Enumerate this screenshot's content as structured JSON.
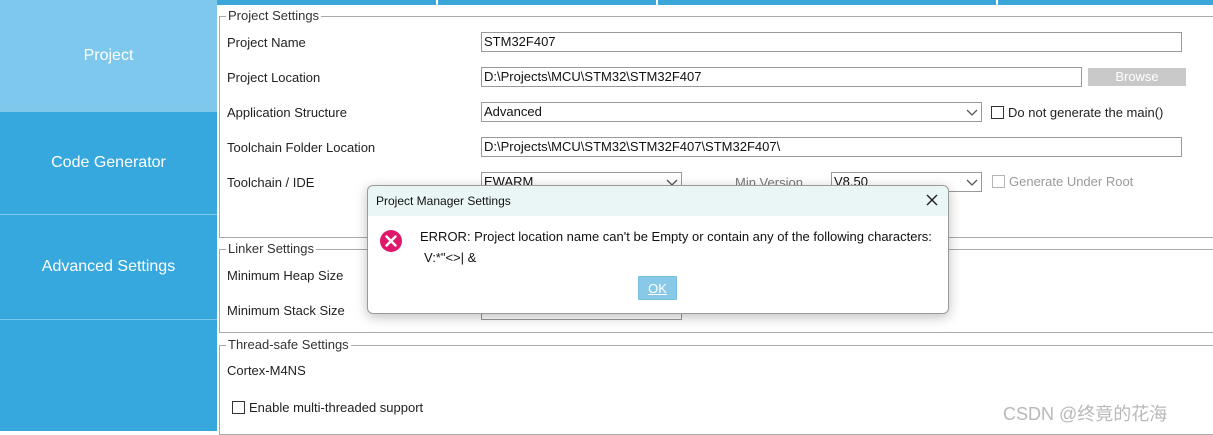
{
  "sidebar": {
    "items": [
      {
        "label": "Project",
        "active": true
      },
      {
        "label": "Code Generator",
        "active": false
      },
      {
        "label": "Advanced Settings",
        "active": false
      }
    ]
  },
  "project_settings": {
    "legend": "Project Settings",
    "project_name_label": "Project Name",
    "project_name_value": "STM32F407",
    "project_location_label": "Project Location",
    "project_location_value": "D:\\Projects\\MCU\\STM32\\STM32F407",
    "browse_label": "Browse",
    "app_structure_label": "Application Structure",
    "app_structure_value": "Advanced",
    "do_not_generate_main_label": "Do not generate the main()",
    "toolchain_folder_label": "Toolchain Folder Location",
    "toolchain_folder_value": "D:\\Projects\\MCU\\STM32\\STM32F407\\STM32F407\\",
    "toolchain_ide_label": "Toolchain / IDE",
    "toolchain_ide_value": "EWARM",
    "min_version_label": "Min Version",
    "min_version_value": "V8.50",
    "generate_under_root_label": "Generate Under Root"
  },
  "linker_settings": {
    "legend": "Linker Settings",
    "min_heap_label": "Minimum Heap Size",
    "min_stack_label": "Minimum Stack Size"
  },
  "thread_safe_settings": {
    "legend": "Thread-safe Settings",
    "core_label": "Cortex-M4NS",
    "enable_multithreaded_label": "Enable multi-threaded support"
  },
  "dialog": {
    "title": "Project Manager Settings",
    "message_line1": "ERROR: Project location name can't be Empty or contain any of the following characters:",
    "message_line2": "V:*\"<>| &",
    "ok_label": "OK"
  },
  "watermark": "CSDN @终竟的花海",
  "colors": {
    "sidebar_bg": "#36a8de",
    "sidebar_active": "#7dc8ec",
    "error_icon": "#e0186c",
    "ok_button": "#88c9e8"
  }
}
